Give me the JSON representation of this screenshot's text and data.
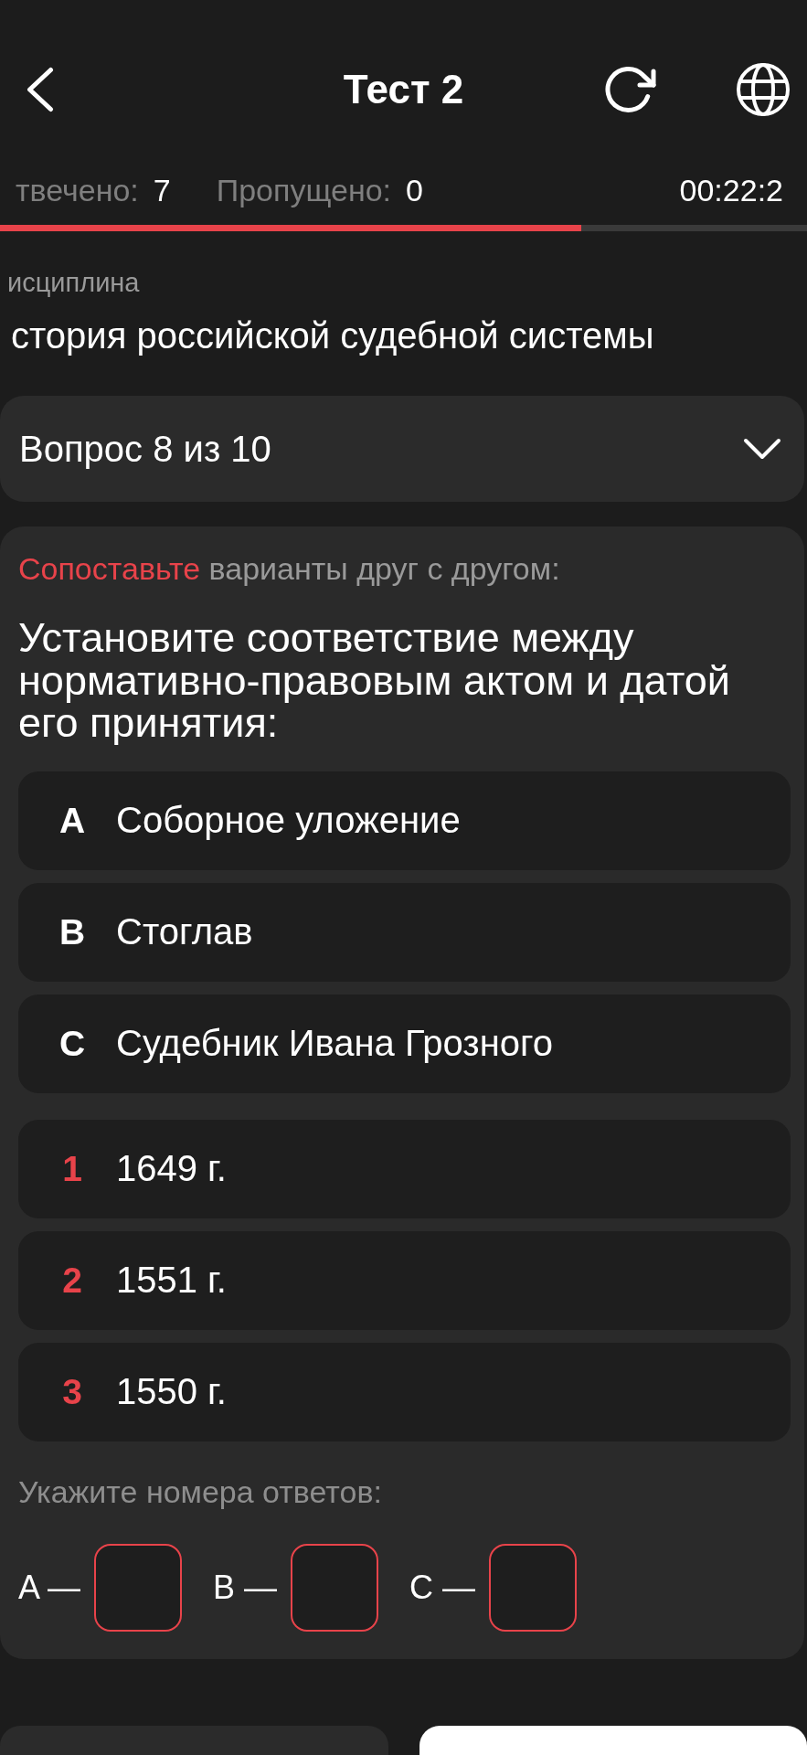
{
  "header": {
    "title": "Тест 2"
  },
  "stats": {
    "answered_label": "твечено:",
    "answered": "7",
    "skipped_label": "Пропущено:",
    "skipped": "0",
    "timer": "00:22:2",
    "progress": {
      "level": 0.72
    }
  },
  "discipline": {
    "label": "исциплина",
    "name": "стория российской судебной системы"
  },
  "question_selector": {
    "label": "Вопрос 8 из 10",
    "expanded": false
  },
  "question": {
    "instruction": "**Сопоставьте** варианты друг с другом:",
    "text": "Установите соответствие между нормативно-правовым актом и датой его принятия:",
    "items": [
      {
        "key": "A",
        "text": "Соборное уложение"
      },
      {
        "key": "B",
        "text": "Стоглав"
      },
      {
        "key": "C",
        "text": "Судебник Ивана Грозного"
      }
    ],
    "matches": [
      {
        "key": "1",
        "text": "1649 г."
      },
      {
        "key": "2",
        "text": "1551 г."
      },
      {
        "key": "3",
        "text": "1550 г."
      }
    ],
    "answer_prompt": "Укажите номера ответов:",
    "answer_slots": [
      {
        "label": "A —"
      },
      {
        "label": "B —"
      },
      {
        "label": "C —"
      }
    ]
  },
  "bottom_buttons": [
    {
      "kind": "secondary"
    },
    {
      "kind": "primary"
    }
  ]
}
